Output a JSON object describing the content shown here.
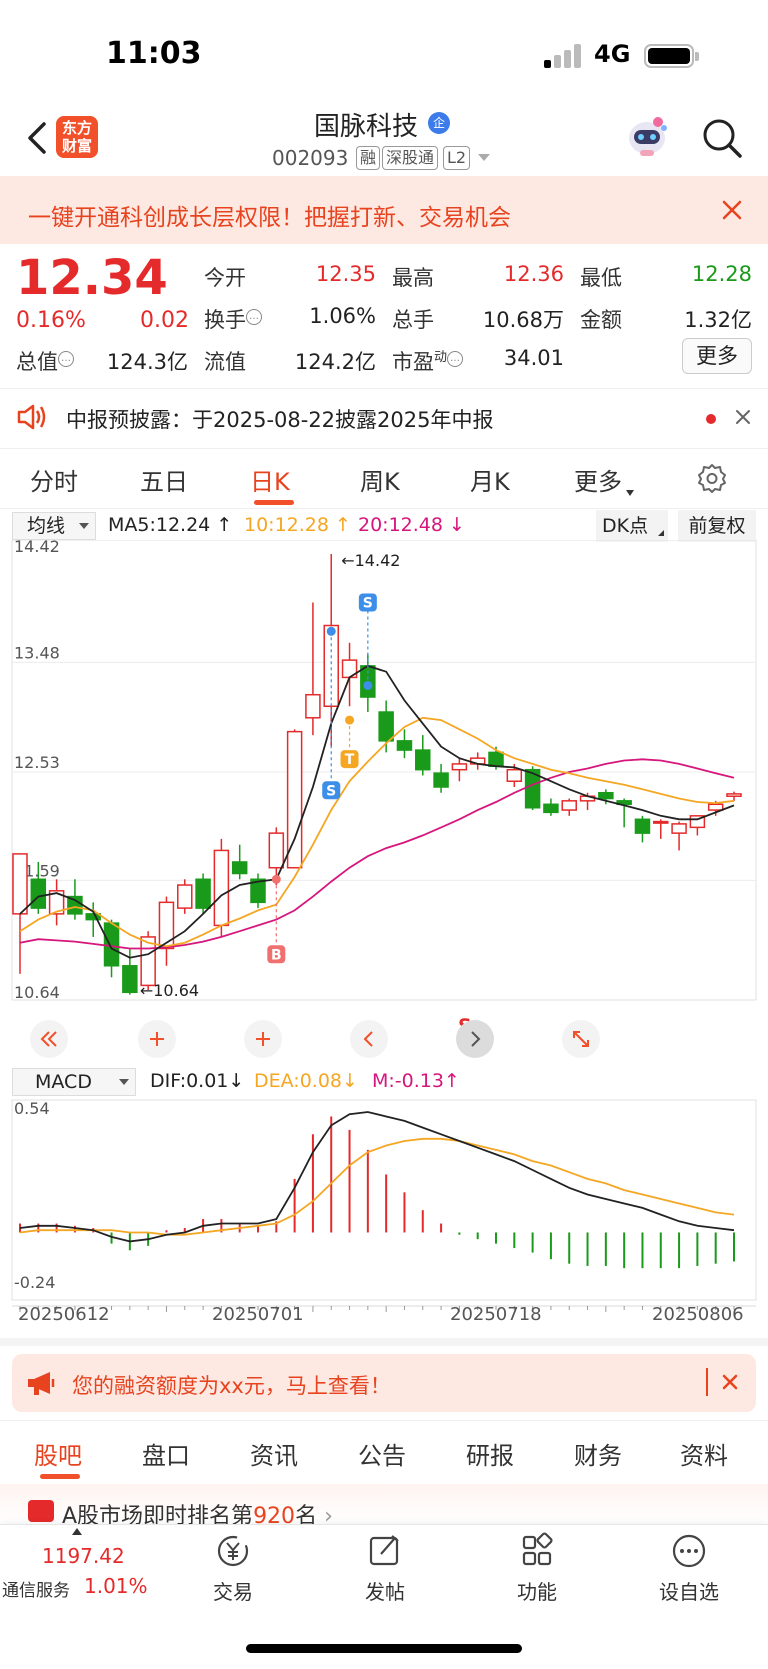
{
  "status": {
    "time": "11:03",
    "network": "4G"
  },
  "header": {
    "logo_line1": "东方",
    "logo_line2": "财富",
    "stock_name": "国脉科技",
    "badge": "企",
    "stock_code": "002093",
    "tags": [
      "融",
      "深股通",
      "L2"
    ]
  },
  "promo": {
    "text": "一键开通科创成长层权限！把握打新、交易机会"
  },
  "quote": {
    "price": "12.34",
    "change_pct": "0.16%",
    "change": "0.02",
    "fields": [
      {
        "label": "今开",
        "value": "12.35",
        "color": "#e42a2a"
      },
      {
        "label": "最高",
        "value": "12.36",
        "color": "#e42a2a"
      },
      {
        "label": "最低",
        "value": "12.28",
        "color": "#1a9a1a"
      },
      {
        "label": "换手",
        "value": "1.06%",
        "color": "#222222"
      },
      {
        "label": "总手",
        "value": "10.68万",
        "color": "#222222"
      },
      {
        "label": "金额",
        "value": "1.32亿",
        "color": "#222222"
      },
      {
        "label": "总值",
        "value": "124.3亿",
        "color": "#222222"
      },
      {
        "label": "流值",
        "value": "124.2亿",
        "color": "#222222"
      },
      {
        "label": "市盈",
        "label_sup": "动",
        "value": "34.01",
        "color": "#222222"
      }
    ],
    "more_label": "更多"
  },
  "notice": {
    "text": "中报预披露：于2025-08-22披露2025年中报"
  },
  "period_tabs": [
    "分时",
    "五日",
    "日K",
    "周K",
    "月K",
    "更多"
  ],
  "active_period": "日K",
  "chart_header": {
    "indicator": "均线",
    "ma5": "MA5:12.24",
    "ma10": "10:12.28",
    "ma20": "20:12.48",
    "dk_label": "DK点",
    "adjust_label": "前复权"
  },
  "colors": {
    "up": "#e42a2a",
    "down": "#1a9a1a",
    "ma5": "#222222",
    "ma10": "#f5a623",
    "ma20": "#d6167c",
    "accent": "#f1502a"
  },
  "chart_data": [
    {
      "type": "candlestick",
      "y_ticks": [
        "14.42",
        "13.48",
        "12.53",
        "11.59",
        "10.64"
      ],
      "ylim": [
        10.64,
        14.42
      ],
      "annotations": {
        "high_label": "14.42",
        "low_label": "10.64",
        "signals": [
          "S",
          "S",
          "T",
          "B",
          "S"
        ]
      },
      "ohlc": [
        {
          "o": 11.3,
          "h": 11.55,
          "l": 10.78,
          "c": 11.82
        },
        {
          "o": 11.6,
          "h": 11.75,
          "l": 11.3,
          "c": 11.35
        },
        {
          "o": 11.3,
          "h": 11.6,
          "l": 11.2,
          "c": 11.5
        },
        {
          "o": 11.45,
          "h": 11.6,
          "l": 11.25,
          "c": 11.3
        },
        {
          "o": 11.3,
          "h": 11.4,
          "l": 11.1,
          "c": 11.25
        },
        {
          "o": 11.22,
          "h": 11.25,
          "l": 10.75,
          "c": 10.85
        },
        {
          "o": 10.85,
          "h": 11.0,
          "l": 10.6,
          "c": 10.62
        },
        {
          "o": 10.68,
          "h": 11.15,
          "l": 10.64,
          "c": 11.1
        },
        {
          "o": 11.0,
          "h": 11.45,
          "l": 10.85,
          "c": 11.4
        },
        {
          "o": 11.35,
          "h": 11.6,
          "l": 11.3,
          "c": 11.55
        },
        {
          "o": 11.6,
          "h": 11.65,
          "l": 11.3,
          "c": 11.35
        },
        {
          "o": 11.2,
          "h": 11.95,
          "l": 11.1,
          "c": 11.85
        },
        {
          "o": 11.75,
          "h": 11.9,
          "l": 11.6,
          "c": 11.65
        },
        {
          "o": 11.6,
          "h": 11.65,
          "l": 11.35,
          "c": 11.4
        },
        {
          "o": 11.7,
          "h": 12.05,
          "l": 11.55,
          "c": 12.0
        },
        {
          "o": 11.7,
          "h": 12.9,
          "l": 11.7,
          "c": 12.88
        },
        {
          "o": 13.0,
          "h": 14.0,
          "l": 12.85,
          "c": 13.2
        },
        {
          "o": 13.1,
          "h": 14.42,
          "l": 12.75,
          "c": 13.8
        },
        {
          "o": 13.35,
          "h": 13.65,
          "l": 13.1,
          "c": 13.5
        },
        {
          "o": 13.45,
          "h": 13.55,
          "l": 13.05,
          "c": 13.18
        },
        {
          "o": 13.05,
          "h": 13.15,
          "l": 12.7,
          "c": 12.8
        },
        {
          "o": 12.8,
          "h": 12.9,
          "l": 12.65,
          "c": 12.72
        },
        {
          "o": 12.72,
          "h": 12.85,
          "l": 12.5,
          "c": 12.55
        },
        {
          "o": 12.52,
          "h": 12.6,
          "l": 12.35,
          "c": 12.4
        },
        {
          "o": 12.55,
          "h": 12.65,
          "l": 12.45,
          "c": 12.6
        },
        {
          "o": 12.6,
          "h": 12.7,
          "l": 12.55,
          "c": 12.65
        },
        {
          "o": 12.7,
          "h": 12.75,
          "l": 12.55,
          "c": 12.58
        },
        {
          "o": 12.45,
          "h": 12.6,
          "l": 12.4,
          "c": 12.55
        },
        {
          "o": 12.55,
          "h": 12.58,
          "l": 12.2,
          "c": 12.22
        },
        {
          "o": 12.25,
          "h": 12.3,
          "l": 12.15,
          "c": 12.18
        },
        {
          "o": 12.2,
          "h": 12.3,
          "l": 12.15,
          "c": 12.28
        },
        {
          "o": 12.28,
          "h": 12.35,
          "l": 12.2,
          "c": 12.32
        },
        {
          "o": 12.35,
          "h": 12.38,
          "l": 12.25,
          "c": 12.3
        },
        {
          "o": 12.28,
          "h": 12.3,
          "l": 12.05,
          "c": 12.25
        },
        {
          "o": 12.12,
          "h": 12.15,
          "l": 11.92,
          "c": 12.0
        },
        {
          "o": 12.1,
          "h": 12.12,
          "l": 11.95,
          "c": 12.1
        },
        {
          "o": 12.0,
          "h": 12.1,
          "l": 11.85,
          "c": 12.08
        },
        {
          "o": 12.05,
          "h": 12.15,
          "l": 11.98,
          "c": 12.15
        },
        {
          "o": 12.2,
          "h": 12.28,
          "l": 12.15,
          "c": 12.25
        },
        {
          "o": 12.32,
          "h": 12.36,
          "l": 12.28,
          "c": 12.34
        }
      ],
      "ma5": [
        11.3,
        11.45,
        11.48,
        11.42,
        11.32,
        11.0,
        10.92,
        10.95,
        11.05,
        11.15,
        11.3,
        11.46,
        11.55,
        11.58,
        11.6,
        11.95,
        12.4,
        12.95,
        13.35,
        13.45,
        13.4,
        13.15,
        12.95,
        12.75,
        12.65,
        12.6,
        12.58,
        12.57,
        12.52,
        12.45,
        12.38,
        12.32,
        12.28,
        12.24,
        12.2,
        12.15,
        12.12,
        12.12,
        12.18,
        12.24
      ],
      "ma10": [
        11.15,
        11.25,
        11.32,
        11.36,
        11.33,
        11.22,
        11.12,
        11.05,
        11.02,
        11.05,
        11.12,
        11.2,
        11.26,
        11.33,
        11.38,
        11.62,
        11.9,
        12.2,
        12.45,
        12.62,
        12.78,
        12.92,
        13.0,
        12.98,
        12.9,
        12.82,
        12.72,
        12.65,
        12.6,
        12.55,
        12.52,
        12.48,
        12.45,
        12.42,
        12.38,
        12.34,
        12.3,
        12.27,
        12.26,
        12.28
      ],
      "ma20": [
        11.05,
        11.08,
        11.07,
        11.06,
        11.04,
        11.02,
        11.0,
        11.0,
        11.01,
        11.03,
        11.06,
        11.1,
        11.15,
        11.2,
        11.25,
        11.33,
        11.45,
        11.58,
        11.7,
        11.8,
        11.87,
        11.92,
        11.98,
        12.05,
        12.12,
        12.2,
        12.27,
        12.35,
        12.42,
        12.48,
        12.53,
        12.56,
        12.6,
        12.63,
        12.64,
        12.63,
        12.6,
        12.56,
        12.52,
        12.48
      ]
    },
    {
      "type": "macd",
      "indicator": "MACD",
      "dif_label": "DIF:0.01",
      "dea_label": "DEA:0.08",
      "m_label": "M:-0.13",
      "y_ticks": [
        "0.54",
        "-0.24"
      ],
      "ylim": [
        -0.24,
        0.54
      ],
      "dif": [
        0.02,
        0.03,
        0.03,
        0.02,
        0.01,
        -0.02,
        -0.04,
        -0.03,
        -0.01,
        0.0,
        0.03,
        0.04,
        0.04,
        0.04,
        0.06,
        0.2,
        0.36,
        0.48,
        0.53,
        0.54,
        0.52,
        0.5,
        0.47,
        0.44,
        0.41,
        0.38,
        0.35,
        0.32,
        0.28,
        0.24,
        0.2,
        0.17,
        0.15,
        0.13,
        0.11,
        0.08,
        0.05,
        0.03,
        0.02,
        0.01
      ],
      "dea": [
        0.0,
        0.01,
        0.01,
        0.01,
        0.01,
        0.01,
        0.0,
        0.0,
        -0.01,
        -0.01,
        0.0,
        0.01,
        0.02,
        0.03,
        0.04,
        0.08,
        0.14,
        0.22,
        0.3,
        0.36,
        0.39,
        0.41,
        0.42,
        0.42,
        0.41,
        0.39,
        0.37,
        0.35,
        0.32,
        0.3,
        0.27,
        0.24,
        0.22,
        0.19,
        0.17,
        0.15,
        0.13,
        0.11,
        0.09,
        0.08
      ],
      "m": [
        0.04,
        0.04,
        0.04,
        0.03,
        0.02,
        -0.05,
        -0.08,
        -0.06,
        0.01,
        0.02,
        0.06,
        0.06,
        0.04,
        0.03,
        0.05,
        0.24,
        0.44,
        0.52,
        0.46,
        0.37,
        0.26,
        0.18,
        0.1,
        0.04,
        -0.01,
        -0.03,
        -0.05,
        -0.07,
        -0.09,
        -0.12,
        -0.14,
        -0.15,
        -0.15,
        -0.16,
        -0.16,
        -0.16,
        -0.16,
        -0.15,
        -0.14,
        -0.13
      ]
    }
  ],
  "dates": [
    "20250612",
    "20250701",
    "20250718",
    "20250806"
  ],
  "financing": {
    "text": "您的融资额度为xx元，马上查看！"
  },
  "bottom_tabs": [
    "股吧",
    "盘口",
    "资讯",
    "公告",
    "研报",
    "财务",
    "资料"
  ],
  "active_bottom_tab": "股吧",
  "rank": {
    "text_prefix": "A股市场即时排名第",
    "rank": "920",
    "text_suffix": "名"
  },
  "toolbar": {
    "index_value": "1197.42",
    "index_name": "通信服务",
    "index_pct": "1.01%",
    "items": [
      {
        "label": "交易",
        "icon": "yen-exchange-icon"
      },
      {
        "label": "发帖",
        "icon": "edit-icon"
      },
      {
        "label": "功能",
        "icon": "grid-icon"
      },
      {
        "label": "设自选",
        "icon": "more-dots-icon"
      }
    ]
  }
}
